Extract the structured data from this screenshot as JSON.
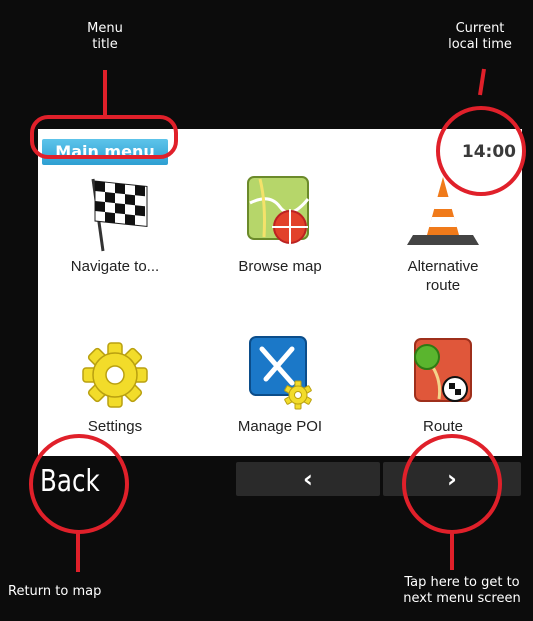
{
  "callouts": {
    "menu_title": "Menu\ntitle",
    "local_time": "Current\nlocal time",
    "return_to_map": "Return to map",
    "next_screen": "Tap here to get to\nnext menu screen"
  },
  "header": {
    "menu_title": "Main menu",
    "clock": "14:00"
  },
  "menu_items": [
    {
      "label": "Navigate to...",
      "icon": "checkered-flag-icon"
    },
    {
      "label": "Browse map",
      "icon": "map-icon"
    },
    {
      "label": "Alternative\nroute",
      "icon": "traffic-cone-icon"
    },
    {
      "label": "Settings",
      "icon": "gear-icon"
    },
    {
      "label": "Manage POI",
      "icon": "poi-icon"
    },
    {
      "label": "Route",
      "icon": "route-map-icon"
    }
  ],
  "controls": {
    "back_label": "Back",
    "prev_label": "‹",
    "next_label": "›"
  },
  "colors": {
    "annotation": "#e0202a",
    "title_badge": "#3aaee0"
  }
}
